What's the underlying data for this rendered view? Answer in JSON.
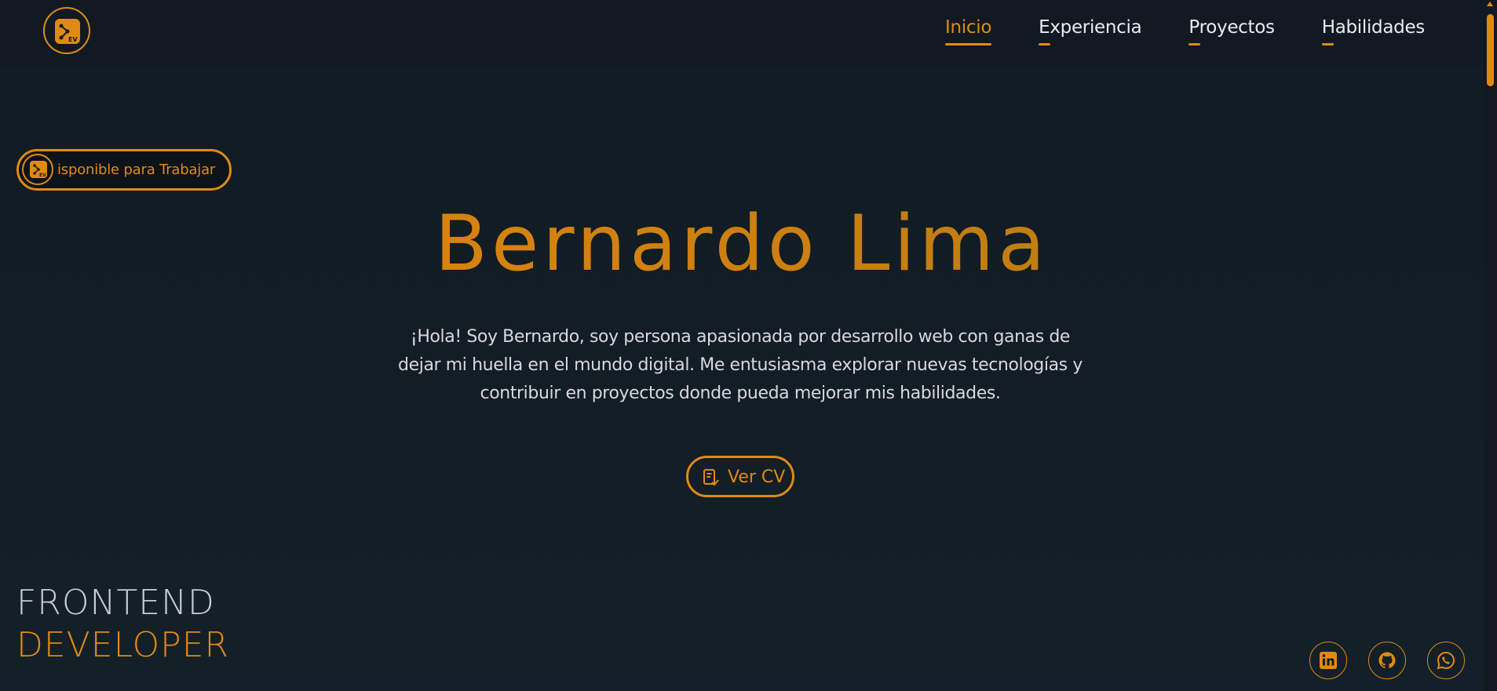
{
  "header": {
    "logo_icon": "dev-logo-icon",
    "nav": [
      {
        "label": "Inicio",
        "active": true
      },
      {
        "label": "Experiencia",
        "active": false
      },
      {
        "label": "Proyectos",
        "active": false
      },
      {
        "label": "Habilidades",
        "active": false
      }
    ]
  },
  "badge": {
    "icon": "dev-logo-icon",
    "text": "isponible para Trabajar"
  },
  "hero": {
    "name": "Bernardo Lima",
    "description": "¡Hola! Soy Bernardo, soy persona apasionada por desarrollo web con ganas de dejar mi huella en el mundo digital. Me entusiasma explorar nuevas tecnologías y contribuir en proyectos donde pueda mejorar mis habilidades.",
    "cv_button": {
      "label": "Ver CV",
      "icon": "document-check-icon"
    }
  },
  "role": {
    "line1": "FRONTEND",
    "line2": "DEVELOPER"
  },
  "social": [
    {
      "name": "linkedin",
      "icon": "linkedin-icon"
    },
    {
      "name": "github",
      "icon": "github-icon"
    },
    {
      "name": "whatsapp",
      "icon": "whatsapp-icon"
    }
  ],
  "colors": {
    "accent": "#e08a14",
    "background": "#121c24",
    "text": "#d6dadd"
  }
}
